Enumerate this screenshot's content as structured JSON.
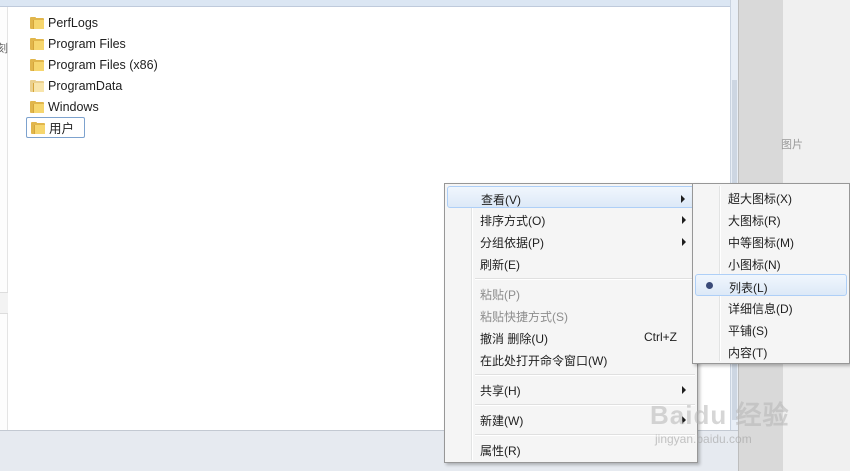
{
  "folders": [
    {
      "name": "PerfLogs"
    },
    {
      "name": "Program Files"
    },
    {
      "name": "Program Files (x86)"
    },
    {
      "name": "ProgramData"
    },
    {
      "name": "Windows"
    },
    {
      "name": "用户"
    }
  ],
  "left_strip_glyph": "刻",
  "right_hint": "图片",
  "context_menu": {
    "view": "查看(V)",
    "sort_by": "排序方式(O)",
    "group_by": "分组依据(P)",
    "refresh": "刷新(E)",
    "paste": "粘贴(P)",
    "paste_shortcut": "粘贴快捷方式(S)",
    "undo_delete": "撤消 删除(U)",
    "undo_delete_shortcut": "Ctrl+Z",
    "open_cmd": "在此处打开命令窗口(W)",
    "share": "共享(H)",
    "new": "新建(W)",
    "properties": "属性(R)"
  },
  "view_submenu": {
    "extra_large_icons": "超大图标(X)",
    "large_icons": "大图标(R)",
    "medium_icons": "中等图标(M)",
    "small_icons": "小图标(N)",
    "list": "列表(L)",
    "details": "详细信息(D)",
    "tiles": "平铺(S)",
    "content": "内容(T)"
  },
  "watermark": {
    "brand": "Baidu 经验",
    "url": "jingyan.baidu.com"
  }
}
